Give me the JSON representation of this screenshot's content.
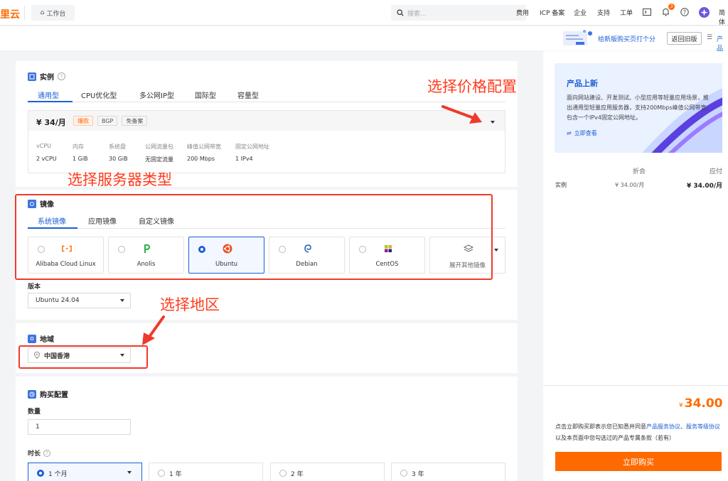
{
  "header": {
    "logo": "里云",
    "workbench": "工作台",
    "search_placeholder": "搜索...",
    "nav": [
      "费用",
      "ICP 备案",
      "企业",
      "支持",
      "工单"
    ],
    "notification_count": "3",
    "lang": "简体"
  },
  "strip": {
    "feedback": "给新版购买页打个分",
    "old_version": "返回旧版",
    "product_link": "产品"
  },
  "instance": {
    "title": "实例",
    "tabs": [
      "通用型",
      "CPU优化型",
      "多公网IP型",
      "国际型",
      "容量型"
    ],
    "active_tab": 0,
    "price": "¥ 34/月",
    "tags": [
      "爆款",
      "BGP",
      "免备案"
    ],
    "spec_labels": [
      "vCPU",
      "内存",
      "系统盘",
      "公网流量包",
      "峰值公网带宽",
      "固定公网地址"
    ],
    "spec_values": [
      "2 vCPU",
      "1 GiB",
      "30 GiB",
      "无固定流量",
      "200 Mbps",
      "1 IPv4"
    ]
  },
  "image": {
    "title": "镜像",
    "tabs": [
      "系统镜像",
      "应用镜像",
      "自定义镜像"
    ],
    "active_tab": 0,
    "cards": [
      "Alibaba Cloud Linux",
      "Anolis",
      "Ubuntu",
      "Debian",
      "CentOS",
      "展开其他镜像"
    ],
    "selected": "Ubuntu",
    "version_label": "版本",
    "version_value": "Ubuntu 24.04"
  },
  "region": {
    "title": "地域",
    "value": "中国香港"
  },
  "purchase": {
    "title": "购买配置",
    "quantity_label": "数量",
    "quantity_value": "1",
    "duration_label": "时长",
    "durations": [
      "1 个月",
      "1 年",
      "2 年",
      "3 年"
    ],
    "selected_duration": "1 个月"
  },
  "annotations": {
    "price": "选择价格配置",
    "server_type": "选择服务器类型",
    "region": "选择地区"
  },
  "side": {
    "promo_title": "产品上新",
    "promo_text": "面向网站建设、开发测试、小型应用等轻量应用场景，推出通用型轻量应用服务器，支持200Mbps峰值公网带宽，包含一个IPv4固定公网地址。",
    "promo_link": "立即查看",
    "col_discount": "折合",
    "col_payable": "应付",
    "row_label": "实例",
    "row_discount": "¥ 34.00/月",
    "row_payable": "¥ 34.00/月",
    "total_symbol": "¥",
    "total": "34.00",
    "agreement_pre": "点击立即购买即表示您已知悉并同意",
    "agreement_link1": "产品服务协议",
    "agreement_sep": "、",
    "agreement_link2": "服务等级协议",
    "agreement_post": "以及本页面中您勾选过的产品专属条款（若有）",
    "buy_button": "立即购买"
  },
  "colors": {
    "accent": "#1b5fd6",
    "brand": "#ff6a00",
    "annotation": "#ee3a2c"
  }
}
